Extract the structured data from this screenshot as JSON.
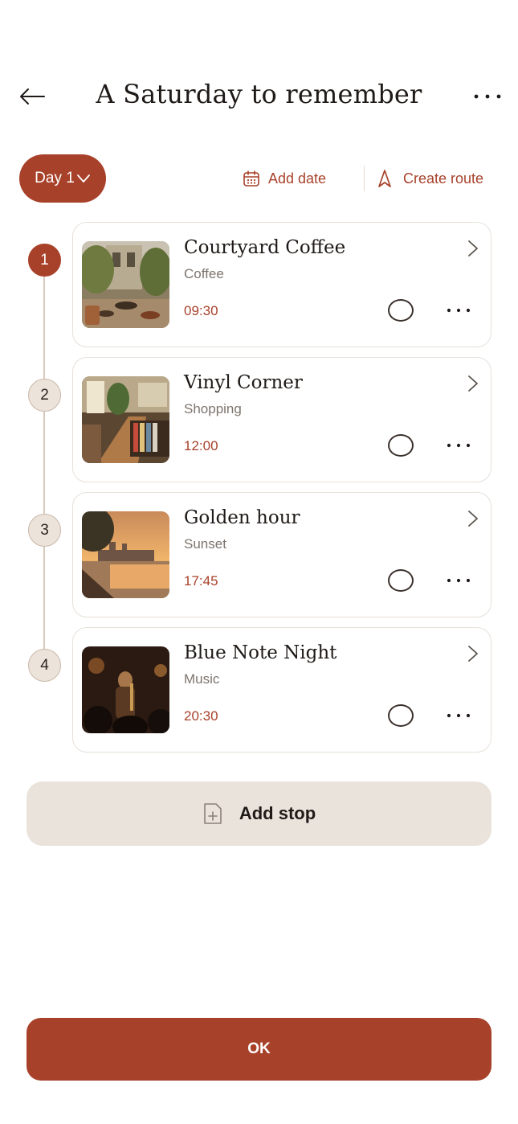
{
  "header": {
    "title": "A Saturday to remember",
    "back_icon": "arrow-left-icon",
    "more_icon": "more-horizontal-icon"
  },
  "toolbar": {
    "day_label": "Day 1",
    "add_date_label": "Add date",
    "create_route_label": "Create route"
  },
  "stops": [
    {
      "index": "1",
      "name": "Courtyard Coffee",
      "category": "Coffee",
      "time": "09:30",
      "active": true
    },
    {
      "index": "2",
      "name": "Vinyl Corner",
      "category": "Shopping",
      "time": "12:00",
      "active": false
    },
    {
      "index": "3",
      "name": "Golden hour",
      "category": "Sunset",
      "time": "17:45",
      "active": false
    },
    {
      "index": "4",
      "name": "Blue Note Night",
      "category": "Music",
      "time": "20:30",
      "active": false
    }
  ],
  "add_stop_label": "Add stop",
  "ok_label": "OK",
  "colors": {
    "accent": "#a8412a",
    "pill_bg": "#eae3dc",
    "timeline": "#d8c9bd"
  }
}
